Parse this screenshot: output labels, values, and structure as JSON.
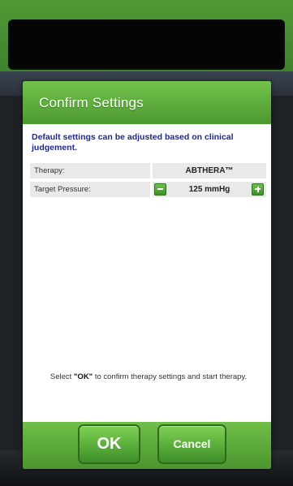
{
  "dialog": {
    "title": "Confirm Settings",
    "info_text": "Default settings can be adjusted based on clinical judgement."
  },
  "settings": {
    "therapy": {
      "label": "Therapy:",
      "value": "ABTHERA™"
    },
    "target_pressure": {
      "label": "Target Pressure:",
      "value": "125 mmHg"
    }
  },
  "instruction": {
    "before": "Select ",
    "ok_word": "\"OK\"",
    "after": " to confirm therapy settings and start therapy."
  },
  "buttons": {
    "ok": "OK",
    "cancel": "Cancel"
  },
  "colors": {
    "accent_green": "#5aac38",
    "info_text_blue": "#1e2a8c",
    "row_background": "#e9e9e9"
  }
}
